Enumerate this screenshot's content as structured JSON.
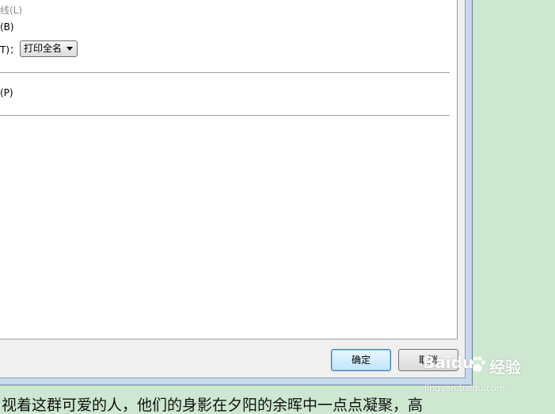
{
  "options": {
    "option1_label": "线(L)",
    "option2_label": "(B)",
    "option3_label": "T)：",
    "combo_value": "打印全名",
    "option4_label": "(P)"
  },
  "buttons": {
    "ok_label": "确定",
    "cancel_label": "取消"
  },
  "document": {
    "text": "视着这群可爱的人，他们的身影在夕阳的余晖中一点点凝聚，高"
  },
  "watermark": {
    "brand": "Bai",
    "brand_tail": "du",
    "cn_label": "经验",
    "sub": "jingyan.baidu.com"
  },
  "colors": {
    "background": "#cde7d0",
    "dialog_frame": "#c7d9ec",
    "default_button_border": "#3c7fb1"
  }
}
